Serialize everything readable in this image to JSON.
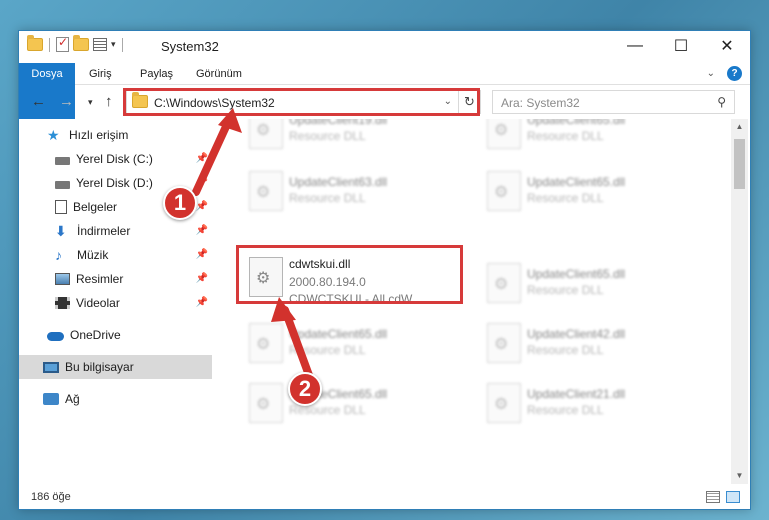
{
  "window": {
    "title": "System32",
    "controls": {
      "minimize": "—",
      "maximize": "☐",
      "close": "✕"
    }
  },
  "ribbon": {
    "tabs": [
      "Dosya",
      "Giriş",
      "Paylaş",
      "Görünüm"
    ],
    "help": "?"
  },
  "nav": {
    "address": "C:\\Windows\\System32",
    "search_placeholder": "Ara: System32"
  },
  "sidebar": {
    "items": [
      {
        "label": "Hızlı erişim",
        "icon": "star-icon"
      },
      {
        "label": "Yerel Disk (C:)",
        "icon": "drive-icon"
      },
      {
        "label": "Yerel Disk (D:)",
        "icon": "drive-icon"
      },
      {
        "label": "Belgeler",
        "icon": "document-icon"
      },
      {
        "label": "İndirmeler",
        "icon": "download-icon"
      },
      {
        "label": "Müzik",
        "icon": "music-icon"
      },
      {
        "label": "Resimler",
        "icon": "pictures-icon"
      },
      {
        "label": "Videolar",
        "icon": "video-icon"
      },
      {
        "label": "OneDrive",
        "icon": "cloud-icon"
      },
      {
        "label": "Bu bilgisayar",
        "icon": "computer-icon"
      },
      {
        "label": "Ağ",
        "icon": "network-icon"
      }
    ]
  },
  "files": [
    {
      "name": "UpdateClient19.dll",
      "type": "Resource DLL"
    },
    {
      "name": "UpdateClient65.dll",
      "type": "Resource DLL"
    },
    {
      "name": "UpdateClient63.dll",
      "type": "Resource DLL"
    },
    {
      "name": "UpdateClient65.dll",
      "type": "Resource DLL"
    },
    {
      "name": "UpdateClient65.dll",
      "type": "Resource DLL"
    },
    {
      "name": "UpdateClient65.dll",
      "type": "Resource DLL"
    },
    {
      "name": "UpdateClient42.dll",
      "type": "Resource DLL"
    },
    {
      "name": "UpdateClient65.dll",
      "type": "Resource DLL"
    },
    {
      "name": "UpdateClient21.dll",
      "type": "Resource DLL"
    }
  ],
  "highlighted_file": {
    "name": "cdwtskui.dll",
    "version": "2000.80.194.0",
    "description": "CDWCTSKUI - All cdW..."
  },
  "status": {
    "count": "186 öğe"
  },
  "callouts": [
    "1",
    "2"
  ],
  "colors": {
    "accent": "#1979ca",
    "annotation": "#d63a3a"
  }
}
